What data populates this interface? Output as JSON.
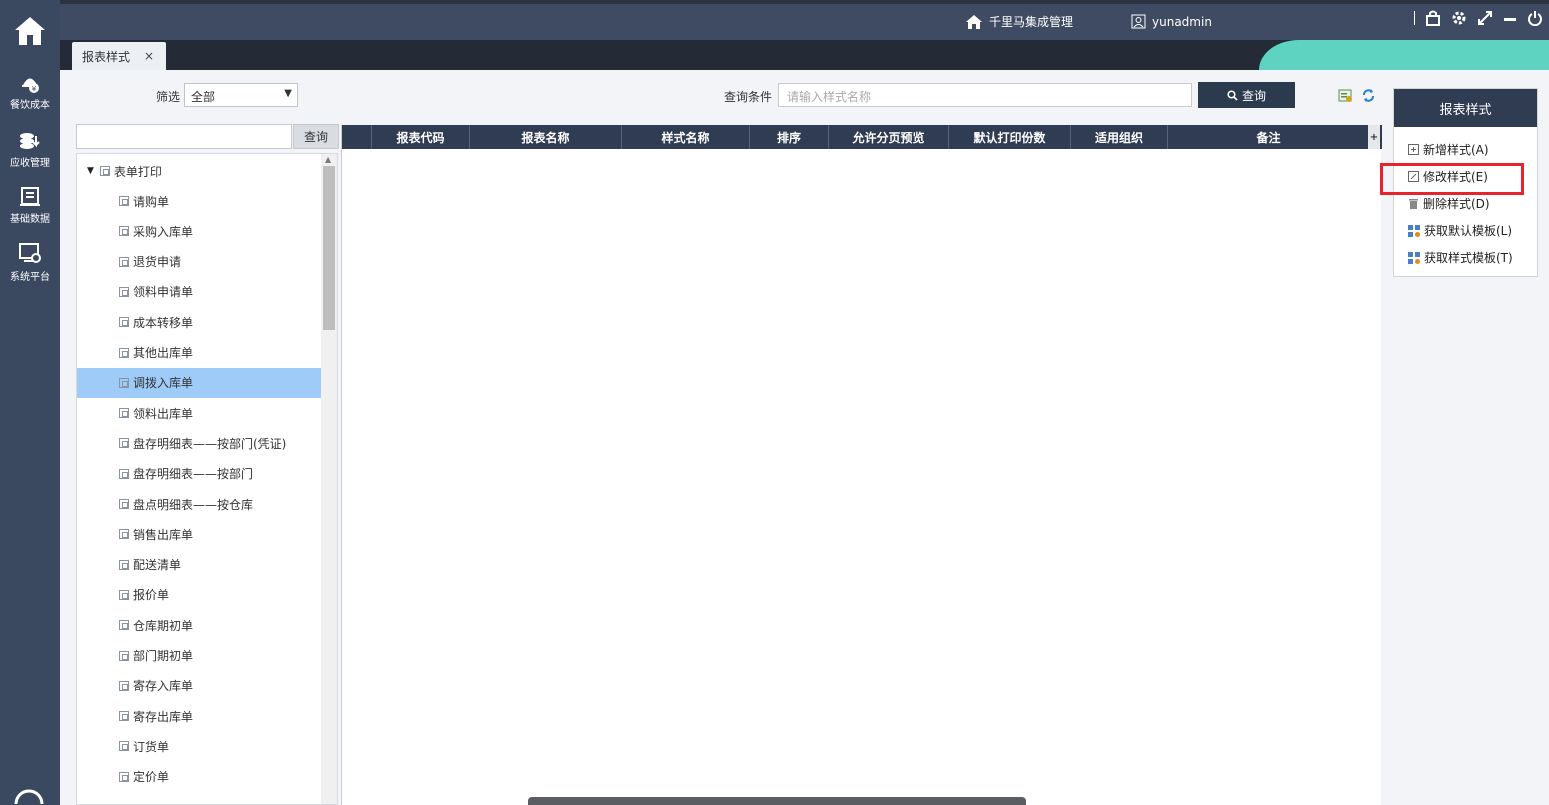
{
  "rail": {
    "items": [
      {
        "label": "餐饮成本",
        "icon": "cost-icon"
      },
      {
        "label": "应收管理",
        "icon": "receivable-icon"
      },
      {
        "label": "基础数据",
        "icon": "base-data-icon"
      },
      {
        "label": "系统平台",
        "icon": "system-icon"
      }
    ]
  },
  "header": {
    "company": "千里马集成管理",
    "user": "yunadmin"
  },
  "tabs": [
    {
      "label": "报表样式",
      "close": "×"
    }
  ],
  "filter": {
    "label": "筛选",
    "selected": "全部",
    "query_label": "查询条件",
    "query_placeholder": "请输入样式名称",
    "query_button": "查询"
  },
  "tree": {
    "search_button": "查询",
    "root": "表单打印",
    "selected_index": 6,
    "items": [
      "请购单",
      "采购入库单",
      "退货申请",
      "领料申请单",
      "成本转移单",
      "其他出库单",
      "调拨入库单",
      "领料出库单",
      "盘存明细表——按部门(凭证)",
      "盘存明细表——按部门",
      "盘点明细表——按仓库",
      "销售出库单",
      "配送清单",
      "报价单",
      "仓库期初单",
      "部门期初单",
      "寄存入库单",
      "寄存出库单",
      "订货单",
      "定价单"
    ]
  },
  "grid": {
    "columns": [
      "报表代码",
      "报表名称",
      "样式名称",
      "排序",
      "允许分页预览",
      "默认打印份数",
      "适用组织",
      "备注"
    ],
    "rows": []
  },
  "right_panel": {
    "title": "报表样式",
    "actions": [
      {
        "label": "新增样式(A)",
        "icon": "add-icon"
      },
      {
        "label": "修改样式(E)",
        "icon": "edit-icon"
      },
      {
        "label": "删除样式(D)",
        "icon": "trash-icon"
      },
      {
        "label": "获取默认模板(L)",
        "icon": "template-icon"
      },
      {
        "label": "获取样式模板(T)",
        "icon": "template-icon"
      }
    ]
  },
  "colors": {
    "rail": "#3a4860",
    "header": "#3f4b63",
    "accent_teal": "#5fd3c2",
    "grid_header": "#2f3c52",
    "selection": "#9ecbf7",
    "highlight": "#e8232b"
  }
}
